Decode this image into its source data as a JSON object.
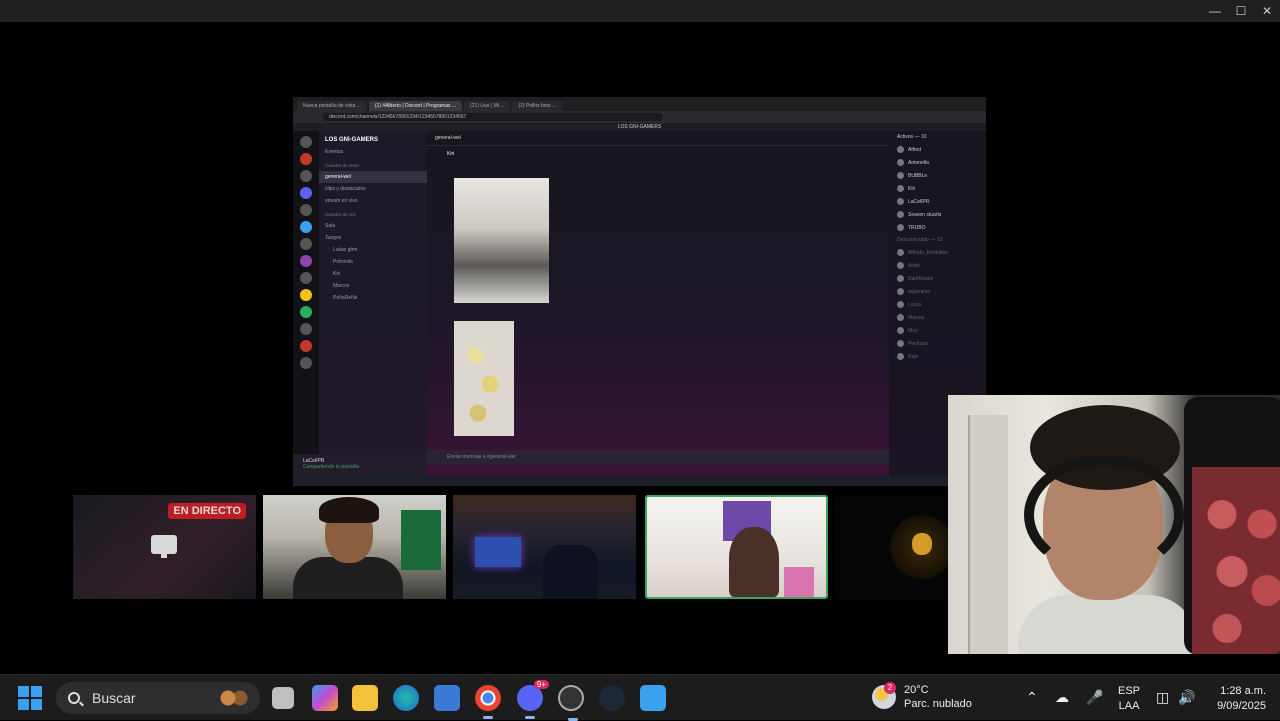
{
  "share": {
    "browser_tabs": [
      "Nueva pestaña de vista ...",
      "(1) #Alberto | Discord | Programas ...",
      "(21) Live | Mi ...",
      "(2) Pollos bros ..."
    ],
    "address": "discord.com/channels/12345678901234/12345678901234567",
    "discord_title": "LOS GNI-GAMERS",
    "server_name": "LOS GNI-GAMERS",
    "channels": [
      "Eventos",
      "Canales de texto",
      "general-wel",
      "clips y destacados",
      "stream en vivo",
      "Canales de voz",
      "Sala",
      "Juegos",
      "Lukas ghm",
      "Petronila",
      "Kiri",
      "Marcos",
      "PeñaDeNe"
    ],
    "chat_header": "general-wel",
    "message_author": "Kiri",
    "compose_placeholder": "Enviar mensaje a #general-wel",
    "user_name": "LaCelIPR",
    "user_status": "Compartiendo tu pantalla",
    "members_header": "Activos — 10",
    "members_online": [
      "Alfred",
      "Antonella",
      "BUBBLe",
      "Kiri",
      "LaCelIPR",
      "Seaven stuarts",
      "TRUBO"
    ],
    "members_offline_header": "Desconectado — 13",
    "members_offline": [
      "Alfredo_Rebeldes",
      "ArdeL",
      "DarkMaster",
      "esperanto",
      "Lucas",
      "Marcos",
      "Moy",
      "Piedrazo",
      "Rojo"
    ]
  },
  "tiles": {
    "live_badge": "EN DIRECTO"
  },
  "taskbar": {
    "search_label": "Buscar",
    "discord_badge": "9+",
    "weather_temp": "20°C",
    "weather_desc": "Parc. nublado",
    "weather_badge": "2",
    "lang_top": "ESP",
    "lang_bottom": "LAA",
    "time": "1:28 a.m.",
    "date": "9/09/2025"
  },
  "colors": {
    "live_red": "#e0242b",
    "speaking_green": "#3ba55c",
    "taskbar_bg": "#1c1c1c"
  }
}
